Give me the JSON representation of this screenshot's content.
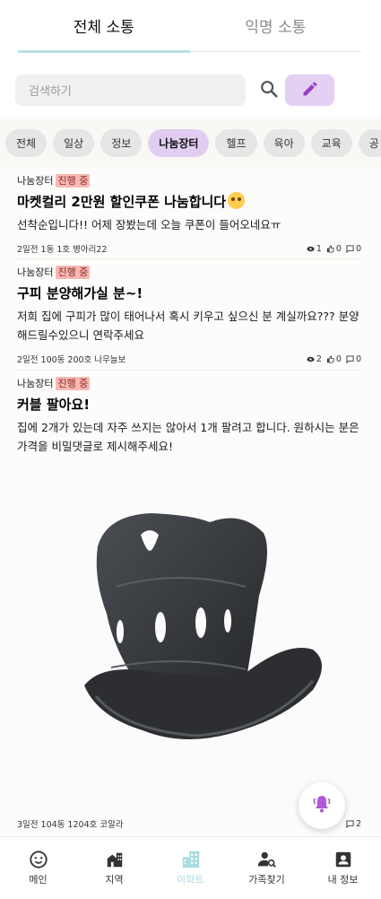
{
  "tabs": [
    {
      "label": "전체 소통",
      "active": true
    },
    {
      "label": "익명 소통",
      "active": false
    }
  ],
  "search": {
    "placeholder": "검색하기"
  },
  "categories": [
    {
      "label": "전체"
    },
    {
      "label": "일상"
    },
    {
      "label": "정보"
    },
    {
      "label": "나눔장터",
      "active": true
    },
    {
      "label": "헬프"
    },
    {
      "label": "육아"
    },
    {
      "label": "교육"
    },
    {
      "label": "공"
    }
  ],
  "posts": [
    {
      "category": "나눔장터",
      "status": "진행 중",
      "title": "마켓컬리 2만원 할인쿠폰 나눔합니다",
      "body": "선착순입니다!! 어제 장봤는데 오늘 쿠폰이 들어오네요ㅠ",
      "meta": "2일전  1동 1호 병아리22",
      "views": "1",
      "likes": "0",
      "comments": "0"
    },
    {
      "category": "나눔장터",
      "status": "진행 중",
      "title": "구피 분양해가실 분~!",
      "body": "저희 집에 구피가 많이 태어나서 혹시 키우고 싶으신 분 계실까요??? 분양해드릴수있으니 연락주세요",
      "meta": "2일전  100동 200호 나무늘보",
      "views": "2",
      "likes": "0",
      "comments": "0"
    },
    {
      "category": "나눔장터",
      "status": "진행 중",
      "title": "커블 팔아요!",
      "body": "집에 2개가 있는데 자주 쓰지는 않아서 1개 팔려고 합니다. 원하시는 분은 가격을 비밀댓글로 제시해주세요!",
      "meta": "3일전  104동 1204호 코알라",
      "comments": "2"
    }
  ],
  "nav": [
    {
      "label": "메인",
      "icon": "smile-icon"
    },
    {
      "label": "지역",
      "icon": "buildings-icon"
    },
    {
      "label": "아파트",
      "icon": "apartment-icon",
      "active": true
    },
    {
      "label": "가족찾기",
      "icon": "person-search-icon"
    },
    {
      "label": "내 정보",
      "icon": "profile-card-icon"
    }
  ],
  "colors": {
    "accent_purple": "#e1cdf1",
    "accent_teal": "#a8dbe0",
    "badge_red": "#f7b9b5"
  }
}
